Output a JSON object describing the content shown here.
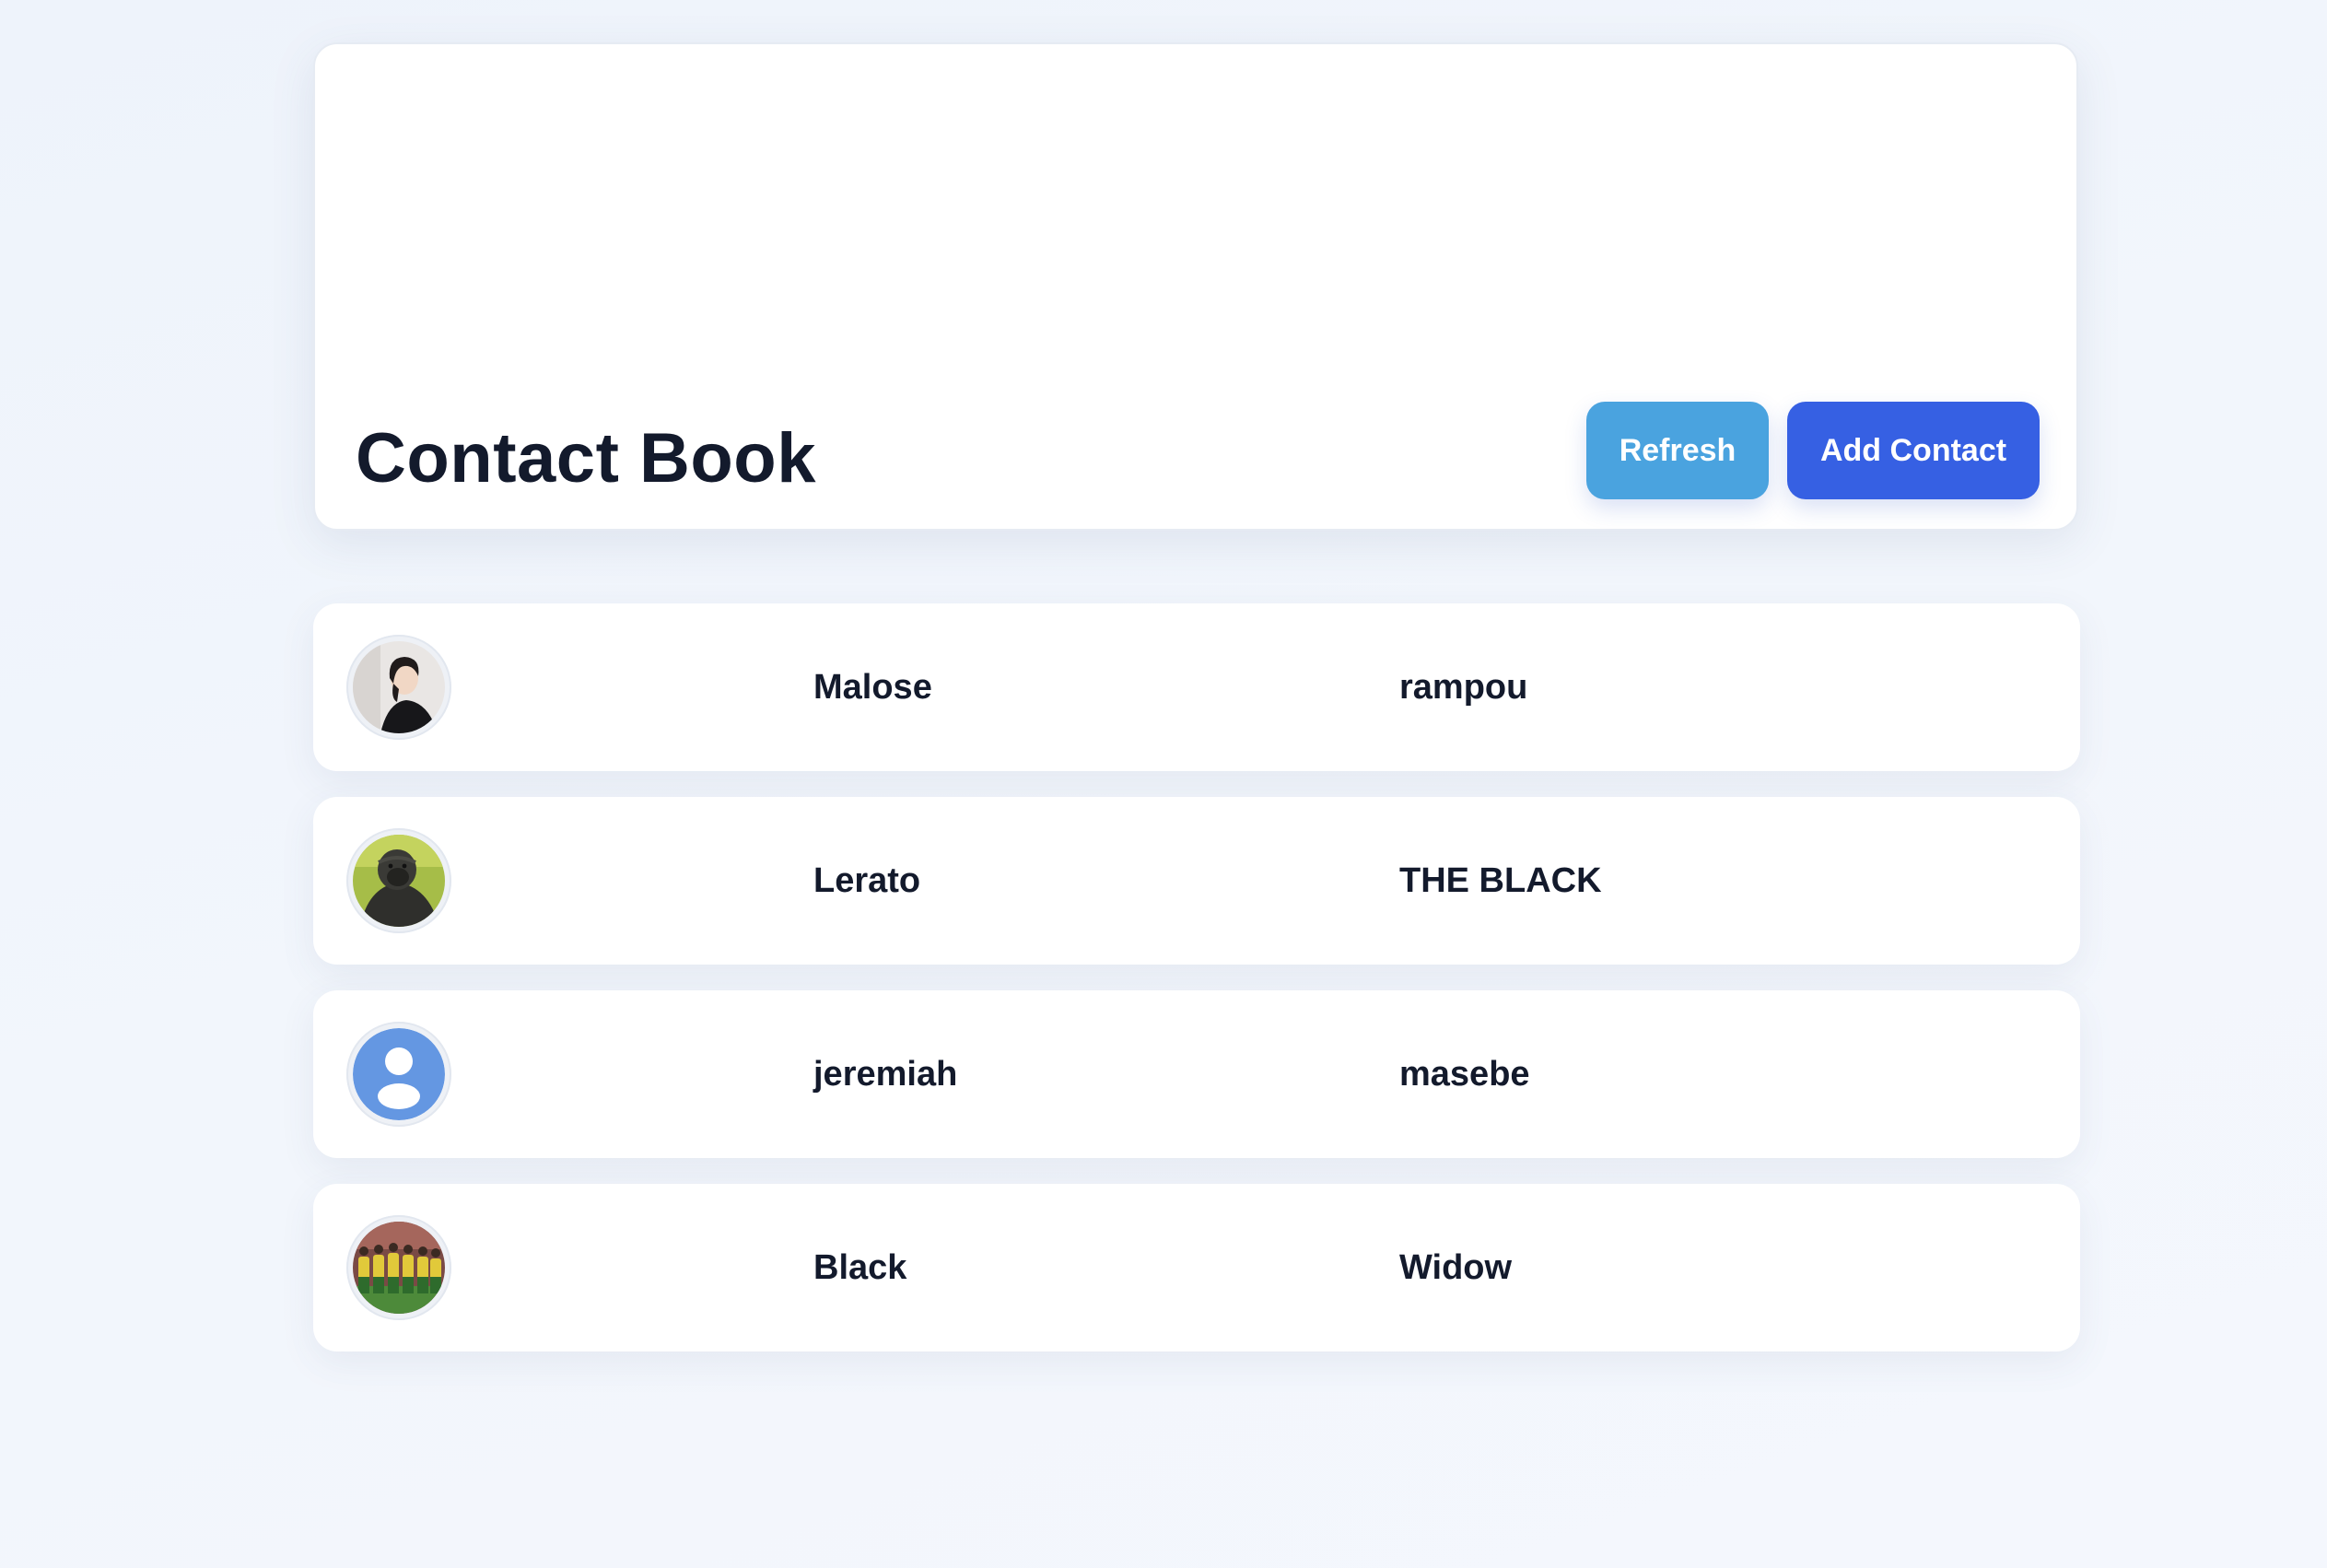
{
  "header": {
    "title": "Contact Book",
    "refresh_label": "Refresh",
    "add_label": "Add Contact"
  },
  "contacts": [
    {
      "first_name": "Malose",
      "last_name": "rampou",
      "avatar": "photo-woman"
    },
    {
      "first_name": "Lerato",
      "last_name": "THE BLACK",
      "avatar": "photo-gorilla"
    },
    {
      "first_name": "jeremiah",
      "last_name": "masebe",
      "avatar": "default-user-icon"
    },
    {
      "first_name": "Black",
      "last_name": "Widow",
      "avatar": "photo-team"
    }
  ],
  "colors": {
    "refresh_button": "#4aa3df",
    "add_button": "#3660e3",
    "text": "#131a2c"
  }
}
